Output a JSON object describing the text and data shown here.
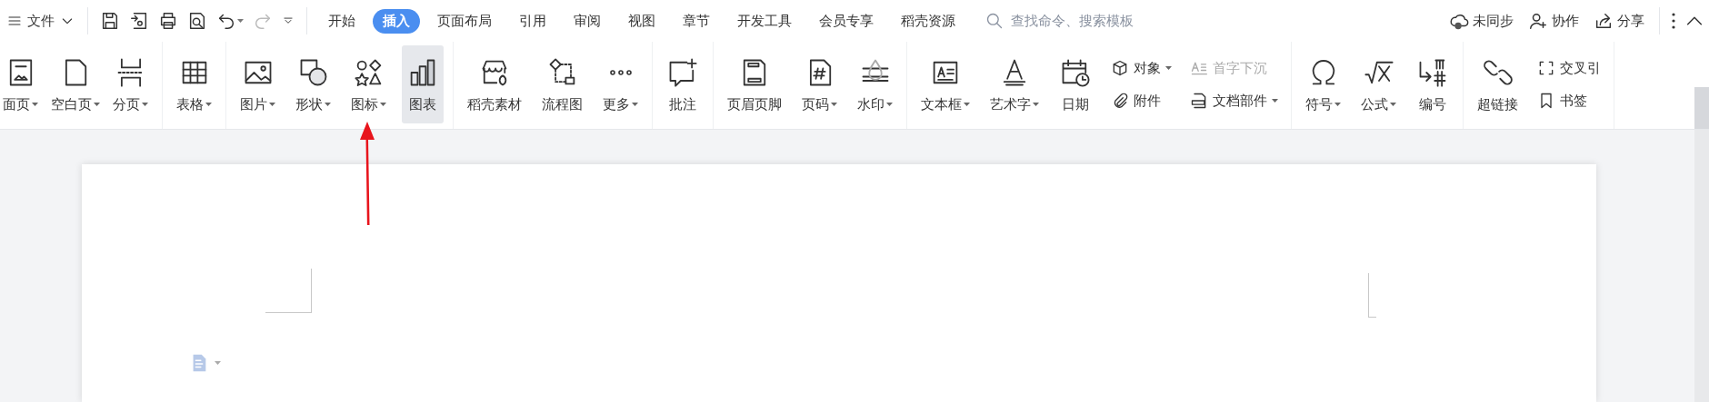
{
  "file_menu": {
    "label": "文件"
  },
  "quick_tools": [
    {
      "kind": "save",
      "disabled": false,
      "dropdown": false
    },
    {
      "kind": "export",
      "disabled": false,
      "dropdown": false
    },
    {
      "kind": "print",
      "disabled": false,
      "dropdown": false
    },
    {
      "kind": "preview",
      "disabled": false,
      "dropdown": false
    },
    {
      "kind": "undo",
      "disabled": false,
      "dropdown": true
    },
    {
      "kind": "redo",
      "disabled": true,
      "dropdown": false
    },
    {
      "kind": "customize",
      "disabled": false,
      "dropdown": false
    }
  ],
  "tabs": [
    {
      "label": "开始",
      "selected": false
    },
    {
      "label": "插入",
      "selected": true
    },
    {
      "label": "页面布局",
      "selected": false
    },
    {
      "label": "引用",
      "selected": false
    },
    {
      "label": "审阅",
      "selected": false
    },
    {
      "label": "视图",
      "selected": false
    },
    {
      "label": "章节",
      "selected": false
    },
    {
      "label": "开发工具",
      "selected": false
    },
    {
      "label": "会员专享",
      "selected": false
    },
    {
      "label": "稻壳资源",
      "selected": false
    }
  ],
  "search": {
    "placeholder": "查找命令、搜索模板"
  },
  "account_actions": [
    {
      "label": "未同步"
    },
    {
      "label": "协作"
    },
    {
      "label": "分享"
    }
  ],
  "ribbon": {
    "groups": [
      {
        "items": [
          {
            "kind": "large",
            "label": "面页",
            "dropdown": true,
            "selected": false,
            "disabled": false
          },
          {
            "kind": "large",
            "label": "空白页",
            "dropdown": true,
            "selected": false,
            "disabled": false
          },
          {
            "kind": "large",
            "label": "分页",
            "dropdown": true,
            "selected": false,
            "disabled": false
          }
        ]
      },
      {
        "items": [
          {
            "kind": "large",
            "label": "表格",
            "dropdown": true,
            "selected": false,
            "disabled": false
          }
        ]
      },
      {
        "items": [
          {
            "kind": "large",
            "label": "图片",
            "dropdown": true,
            "selected": false,
            "disabled": false
          },
          {
            "kind": "large",
            "label": "形状",
            "dropdown": true,
            "selected": false,
            "disabled": false
          },
          {
            "kind": "large",
            "label": "图标",
            "dropdown": true,
            "selected": false,
            "disabled": false
          },
          {
            "kind": "large",
            "label": "图表",
            "dropdown": false,
            "selected": true,
            "disabled": false
          }
        ]
      },
      {
        "items": [
          {
            "kind": "large",
            "label": "稻壳素材",
            "dropdown": false,
            "selected": false,
            "disabled": false
          },
          {
            "kind": "large",
            "label": "流程图",
            "dropdown": false,
            "selected": false,
            "disabled": false
          },
          {
            "kind": "large",
            "label": "更多",
            "dropdown": true,
            "selected": false,
            "disabled": false
          }
        ]
      },
      {
        "items": [
          {
            "kind": "large",
            "label": "批注",
            "dropdown": false,
            "selected": false,
            "disabled": false
          }
        ]
      },
      {
        "items": [
          {
            "kind": "large",
            "label": "页眉页脚",
            "dropdown": false,
            "selected": false,
            "disabled": false
          },
          {
            "kind": "large",
            "label": "页码",
            "dropdown": true,
            "selected": false,
            "disabled": false
          },
          {
            "kind": "large",
            "label": "水印",
            "dropdown": true,
            "selected": false,
            "disabled": false
          }
        ]
      },
      {
        "items": [
          {
            "kind": "large",
            "label": "文本框",
            "dropdown": true,
            "selected": false,
            "disabled": false
          },
          {
            "kind": "large",
            "label": "艺术字",
            "dropdown": true,
            "selected": false,
            "disabled": false
          },
          {
            "kind": "large",
            "label": "日期",
            "dropdown": false,
            "selected": false,
            "disabled": false
          },
          {
            "kind": "stack",
            "items": [
              {
                "label": "对象",
                "dropdown": true,
                "selected": false,
                "disabled": false
              },
              {
                "label": "附件",
                "dropdown": false,
                "selected": false,
                "disabled": false
              }
            ]
          },
          {
            "kind": "stack",
            "items": [
              {
                "label": "首字下沉",
                "dropdown": false,
                "selected": false,
                "disabled": true
              },
              {
                "label": "文档部件",
                "dropdown": true,
                "selected": false,
                "disabled": false
              }
            ]
          }
        ]
      },
      {
        "items": [
          {
            "kind": "large",
            "label": "符号",
            "dropdown": true,
            "selected": false,
            "disabled": false
          },
          {
            "kind": "large",
            "label": "公式",
            "dropdown": true,
            "selected": false,
            "disabled": false
          },
          {
            "kind": "large",
            "label": "编号",
            "dropdown": false,
            "selected": false,
            "disabled": false
          }
        ]
      },
      {
        "items": [
          {
            "kind": "large",
            "label": "超链接",
            "dropdown": false,
            "selected": false,
            "disabled": false
          },
          {
            "kind": "stack",
            "items": [
              {
                "label": "交叉引",
                "dropdown": false,
                "selected": false,
                "disabled": false
              },
              {
                "label": "书签",
                "dropdown": false,
                "selected": false,
                "disabled": false
              }
            ]
          }
        ]
      }
    ]
  }
}
